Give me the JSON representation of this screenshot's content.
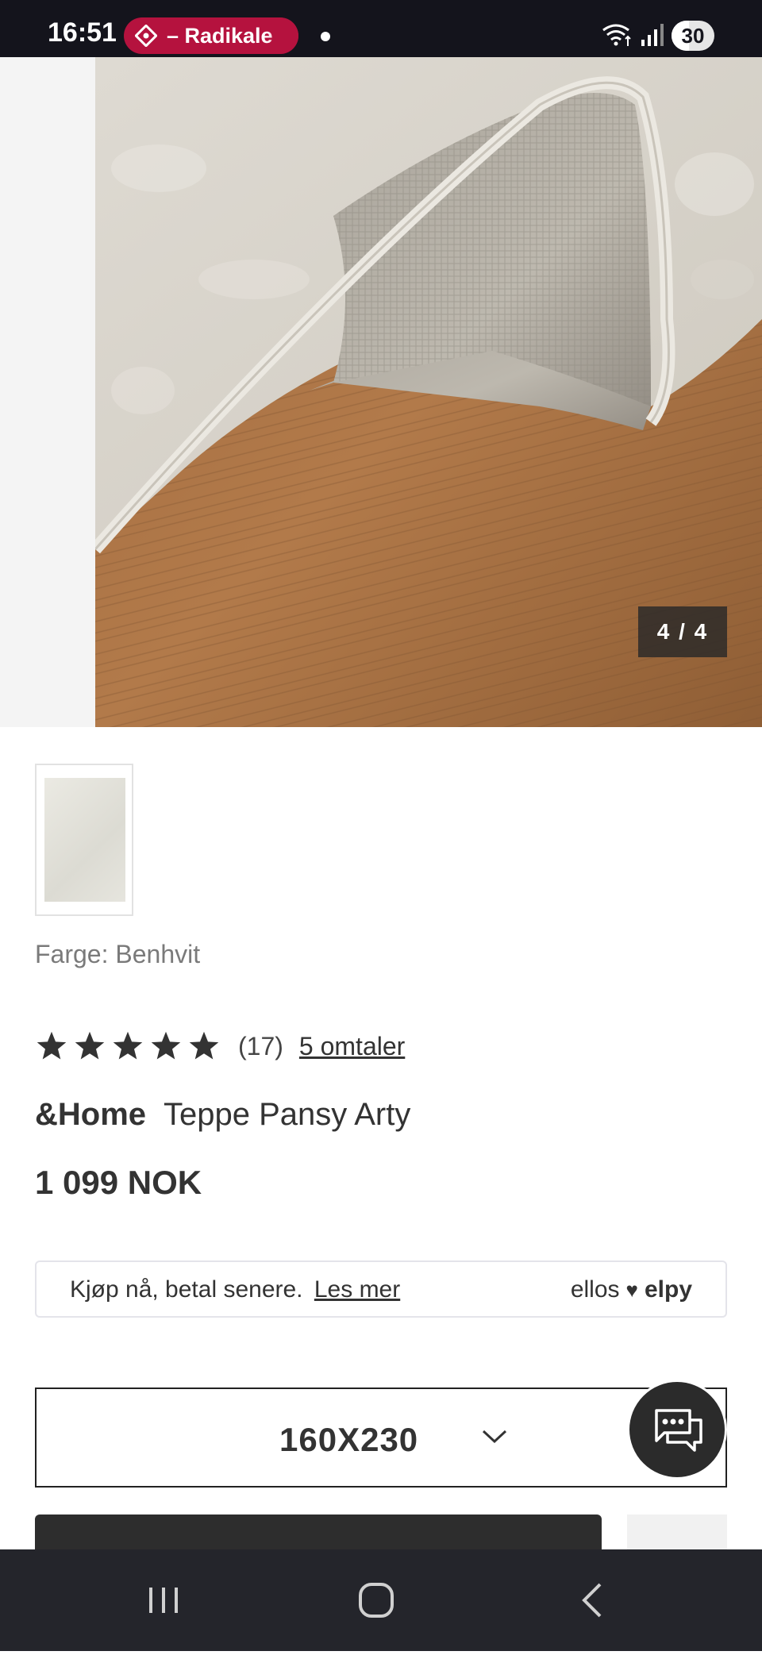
{
  "status_bar": {
    "time": "16:51",
    "media_pill_text": "– Radikale",
    "battery_level": "30",
    "icons": [
      "radio-icon",
      "notification-dot",
      "wifi-icon",
      "signal-icon",
      "battery-icon"
    ]
  },
  "gallery": {
    "counter": "4 / 4",
    "image_subject": "rug-corner-on-wood-floor"
  },
  "product": {
    "color_label": "Farge: Benhvit",
    "rating_stars": 5,
    "rating_count": "(17)",
    "reviews_link": "5 omtaler",
    "brand": "&Home",
    "name": "Teppe Pansy Arty",
    "price": "1 099 NOK"
  },
  "payment": {
    "text": "Kjøp nå, betal senere.",
    "link": "Les mer",
    "logo_left": "ellos",
    "logo_right": "elpy"
  },
  "size_selector": {
    "value": "160X230"
  },
  "colors": {
    "status_bar_bg": "#14141c",
    "media_pill": "#b5123e",
    "text_primary": "#333333",
    "nav_bar_bg": "#24252b"
  }
}
